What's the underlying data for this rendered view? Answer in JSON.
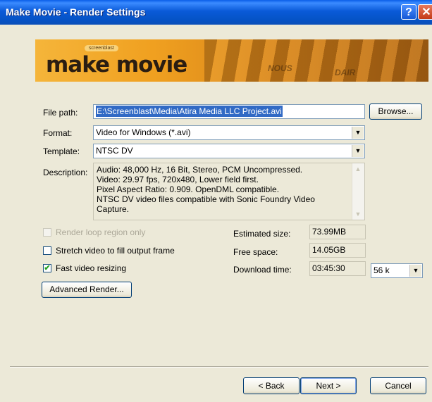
{
  "window": {
    "title": "Make Movie - Render Settings",
    "help_label": "?",
    "close_label": "✕"
  },
  "banner": {
    "brand_small": "screenblast",
    "brand_big": "make movie",
    "deco_1": "NOUS",
    "deco_2": "DAIR"
  },
  "file_path": {
    "label": "File path:",
    "value": "E:\\Screenblast\\Media\\Atira Media LLC Project.avi",
    "browse_label": "Browse..."
  },
  "format": {
    "label": "Format:",
    "value": "Video for Windows (*.avi)"
  },
  "template": {
    "label": "Template:",
    "value": "NTSC DV"
  },
  "description": {
    "label": "Description:",
    "lines": [
      "Audio: 48,000 Hz, 16 Bit, Stereo, PCM Uncompressed.",
      "Video: 29.97 fps, 720x480, Lower field first.",
      "Pixel Aspect Ratio: 0.909. OpenDML compatible.",
      "NTSC DV video files compatible with Sonic Foundry Video",
      "Capture."
    ]
  },
  "options": {
    "render_loop": {
      "label": "Render loop region only",
      "checked": false,
      "disabled": true
    },
    "stretch": {
      "label": "Stretch video to fill output frame",
      "checked": false
    },
    "fast_resize": {
      "label": "Fast video resizing",
      "checked": true
    }
  },
  "stats": {
    "estimated_label": "Estimated size:",
    "estimated_value": "73.99MB",
    "free_label": "Free space:",
    "free_value": "14.05GB",
    "download_label": "Download time:",
    "download_value": "03:45:30",
    "speed_value": "56 k"
  },
  "buttons": {
    "advanced": "Advanced Render...",
    "back": "< Back",
    "next": "Next >",
    "cancel": "Cancel"
  },
  "colors": {
    "titlebar": "#0a5ad8",
    "dialog_bg": "#ece9d8",
    "selection": "#316ac5",
    "checkmark": "#21a121"
  }
}
